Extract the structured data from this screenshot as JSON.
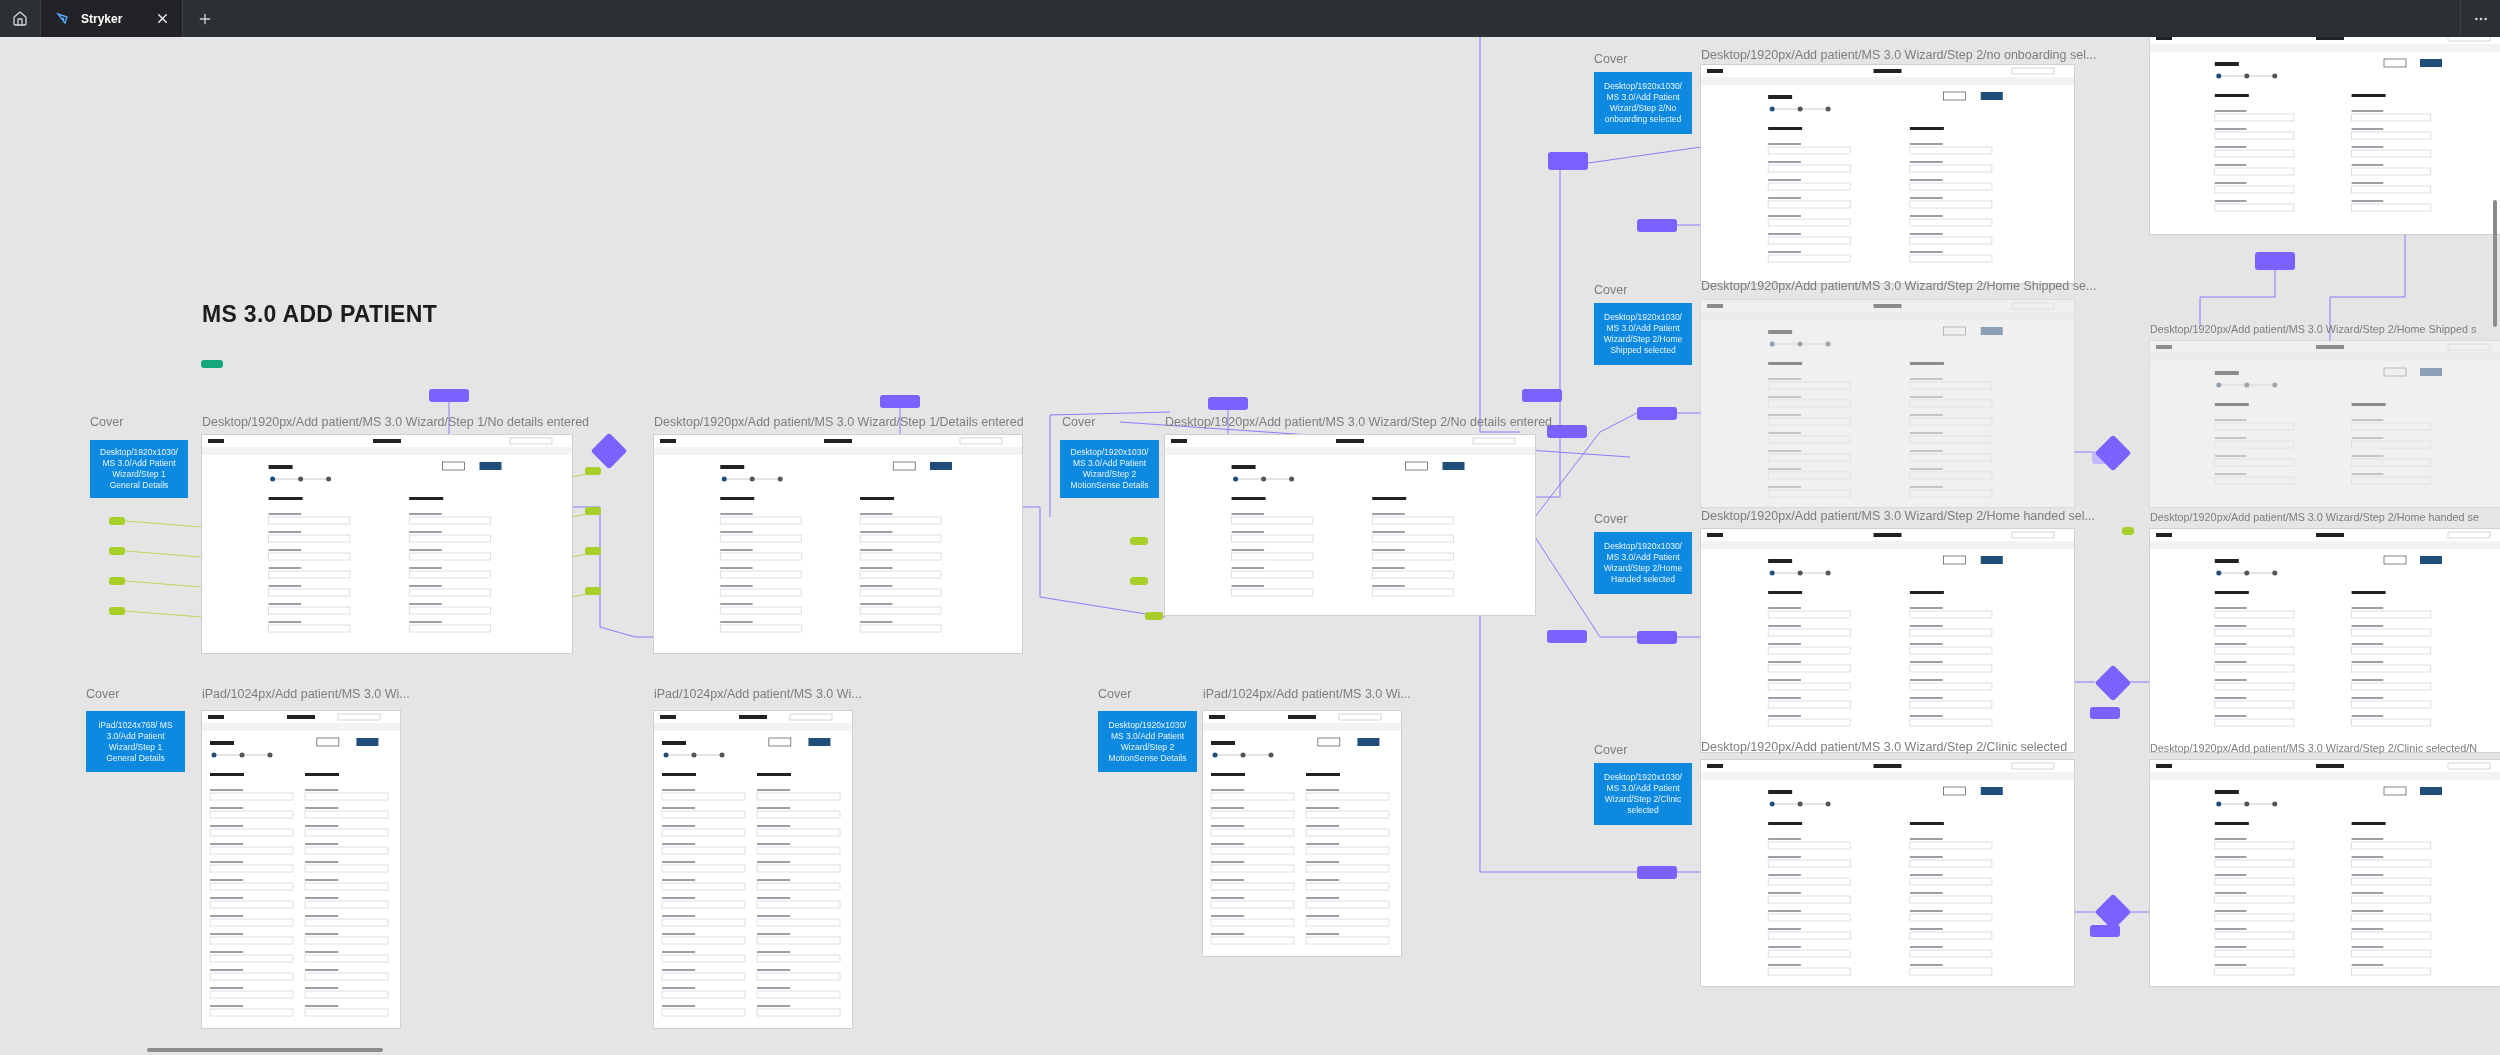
{
  "tab_bar": {
    "tabs": [
      {
        "label": "Stryker",
        "selected": true
      }
    ]
  },
  "page_title": "MS 3.0 ADD PATIENT",
  "covers": [
    {
      "label": "Cover",
      "text": "Desktop/1920x1030/ MS 3.0/Add Patient Wizard/Step 1 General Details"
    },
    {
      "label": "Cover",
      "text": "Desktop/1920x1030/ MS 3.0/Add Patient Wizard/Step 2 MotionSense Details"
    },
    {
      "label": "Cover",
      "text": "Desktop/1920x1030/ MS 3.0/Add Patient Wizard/Step 2/No onboarding selected"
    },
    {
      "label": "Cover",
      "text": "Desktop/1920x1030/ MS 3.0/Add Patient Wizard/Step 2/Home Shipped selected"
    },
    {
      "label": "Cover",
      "text": "Desktop/1920x1030/ MS 3.0/Add Patient Wizard/Step 2/Home Handed selected"
    },
    {
      "label": "Cover",
      "text": "Desktop/1920x1030/ MS 3.0/Add Patient Wizard/Step 2/Clinic selected"
    },
    {
      "label": "Cover",
      "text": "iPad/1024x768/ MS 3.0/Add Patient Wizard/Step 1 General Details"
    },
    {
      "label": "Cover",
      "text": "Desktop/1920x1030/ MS 3.0/Add Patient Wizard/Step 2 MotionSense Details"
    }
  ],
  "frames": [
    {
      "label": "Desktop/1920px/Add patient/MS 3.0 Wizard/Step 1/No details entered",
      "kind": "desktop",
      "dimmed": false
    },
    {
      "label": "Desktop/1920px/Add patient/MS 3.0 Wizard/Step 1/Details entered",
      "kind": "desktop",
      "dimmed": false
    },
    {
      "label": "Desktop/1920px/Add patient/MS 3.0 Wizard/Step 2/No details entered",
      "kind": "desktop",
      "dimmed": false
    },
    {
      "label": "Desktop/1920px/Add patient/MS 3.0 Wizard/Step 2/no onboarding sel...",
      "kind": "desktop",
      "dimmed": false
    },
    {
      "label": "Desktop/1920px/Add patient/MS 3.0 Wizard/Step 2/Home Shipped se...",
      "kind": "desktop",
      "dimmed": true
    },
    {
      "label": "Desktop/1920px/Add patient/MS 3.0 Wizard/Step 2/Home handed sel...",
      "kind": "desktop",
      "dimmed": false
    },
    {
      "label": "Desktop/1920px/Add patient/MS 3.0 Wizard/Step 2/Clinic selected",
      "kind": "desktop",
      "dimmed": false
    },
    {
      "label": "Desktop/1920px/Add patient/MS 3.0 Wizard/Step 2/Home Shipped s",
      "kind": "desktop",
      "dimmed": true
    },
    {
      "label": "Desktop/1920px/Add patient/MS 3.0 Wizard/Step 2/Home handed se",
      "kind": "desktop",
      "dimmed": false
    },
    {
      "label": "Desktop/1920px/Add patient/MS 3.0 Wizard/Step 2/Clinic selected/N",
      "kind": "desktop",
      "dimmed": false
    },
    {
      "label": "iPad/1024px/Add patient/MS 3.0 Wi...",
      "kind": "ipad",
      "dimmed": false
    },
    {
      "label": "iPad/1024px/Add patient/MS 3.0 Wi...",
      "kind": "ipad",
      "dimmed": false
    },
    {
      "label": "iPad/1024px/Add patient/MS 3.0 Wi...",
      "kind": "ipad",
      "dimmed": false
    },
    {
      "kind": "desktop",
      "dimmed": false
    }
  ]
}
